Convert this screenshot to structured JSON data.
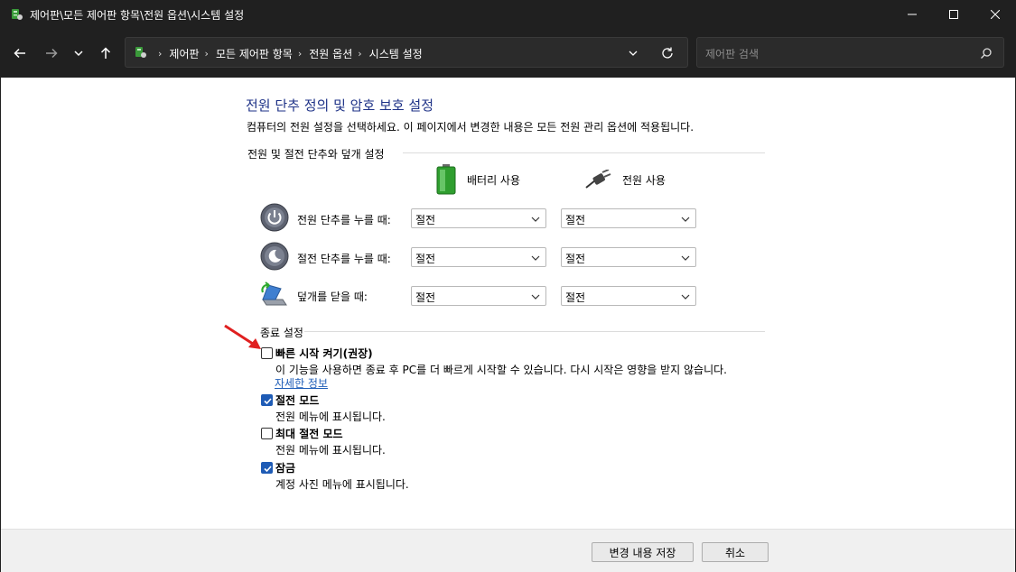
{
  "window": {
    "title": "제어판\\모든 제어판 항목\\전원 옵션\\시스템 설정"
  },
  "address": {
    "crumbs": [
      "제어판",
      "모든 제어판 항목",
      "전원 옵션",
      "시스템 설정"
    ],
    "search_placeholder": "제어판 검색"
  },
  "page": {
    "heading": "전원 단추 정의 및 암호 보호 설정",
    "subtext": "컴퓨터의 전원 설정을 선택하세요. 이 페이지에서 변경한 내용은 모든 전원 관리 옵션에 적용됩니다."
  },
  "power_section": {
    "title": "전원 및 절전 단추와 덮개 설정",
    "columns": [
      "배터리 사용",
      "전원 사용"
    ],
    "rows": [
      {
        "label": "전원 단추를 누를 때:",
        "battery": "절전",
        "plugged": "절전",
        "icon": "power-button-icon"
      },
      {
        "label": "절전 단추를 누를 때:",
        "battery": "절전",
        "plugged": "절전",
        "icon": "sleep-button-icon"
      },
      {
        "label": "덮개를 닫을 때:",
        "battery": "절전",
        "plugged": "절전",
        "icon": "laptop-lid-icon"
      }
    ]
  },
  "shutdown_section": {
    "title": "종료 설정",
    "options": [
      {
        "label": "빠른 시작 켜기(권장)",
        "desc": "이 기능을 사용하면 종료 후 PC를 더 빠르게 시작할 수 있습니다. 다시 시작은 영향을 받지 않습니다.",
        "link": "자세한 정보",
        "checked": false
      },
      {
        "label": "절전 모드",
        "desc": "전원 메뉴에 표시됩니다.",
        "checked": true
      },
      {
        "label": "최대 절전 모드",
        "desc": "전원 메뉴에 표시됩니다.",
        "checked": false
      },
      {
        "label": "잠금",
        "desc": "계정 사진 메뉴에 표시됩니다.",
        "checked": true
      }
    ]
  },
  "footer": {
    "save_label": "변경 내용 저장",
    "cancel_label": "취소"
  },
  "colors": {
    "heading": "#1e3287",
    "checkbox_checked": "#1e5bb5",
    "link": "#1f5eb8",
    "annotation_arrow": "#e02020"
  }
}
